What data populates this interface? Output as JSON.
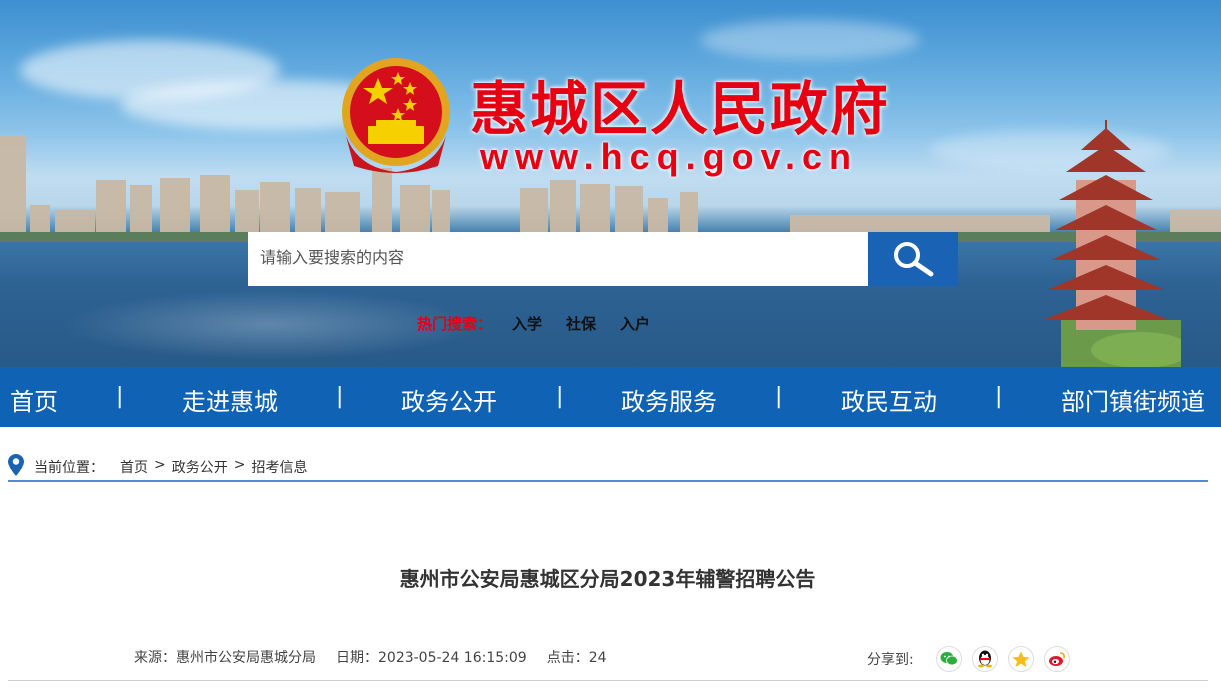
{
  "header": {
    "title": "惠城区人民政府",
    "url": "www.hcq.gov.cn"
  },
  "search": {
    "placeholder": "请输入要搜索的内容",
    "hot_label": "热门搜索：",
    "hot_items": [
      "入学",
      "社保",
      "入户"
    ]
  },
  "nav": {
    "items": [
      "首页",
      "走进惠城",
      "政务公开",
      "政务服务",
      "政民互动",
      "部门镇街频道"
    ],
    "separator": "|"
  },
  "breadcrumb": {
    "label": "当前位置：",
    "items": [
      "首页",
      "政务公开",
      "招考信息"
    ],
    "separator": ">"
  },
  "article": {
    "title": "惠州市公安局惠城区分局2023年辅警招聘公告",
    "source": "来源：惠州市公安局惠城分局",
    "date": "日期：2023-05-24 16:15:09",
    "clicks": "点击：24"
  },
  "share": {
    "label": "分享到:",
    "icons": [
      "wechat-icon",
      "qq-icon",
      "qzone-icon",
      "weibo-icon"
    ]
  },
  "colors": {
    "brand_red": "#e60012",
    "nav_blue": "#0f62b4",
    "search_blue": "#1a63b4",
    "crumb_line": "#4b8fd6"
  }
}
